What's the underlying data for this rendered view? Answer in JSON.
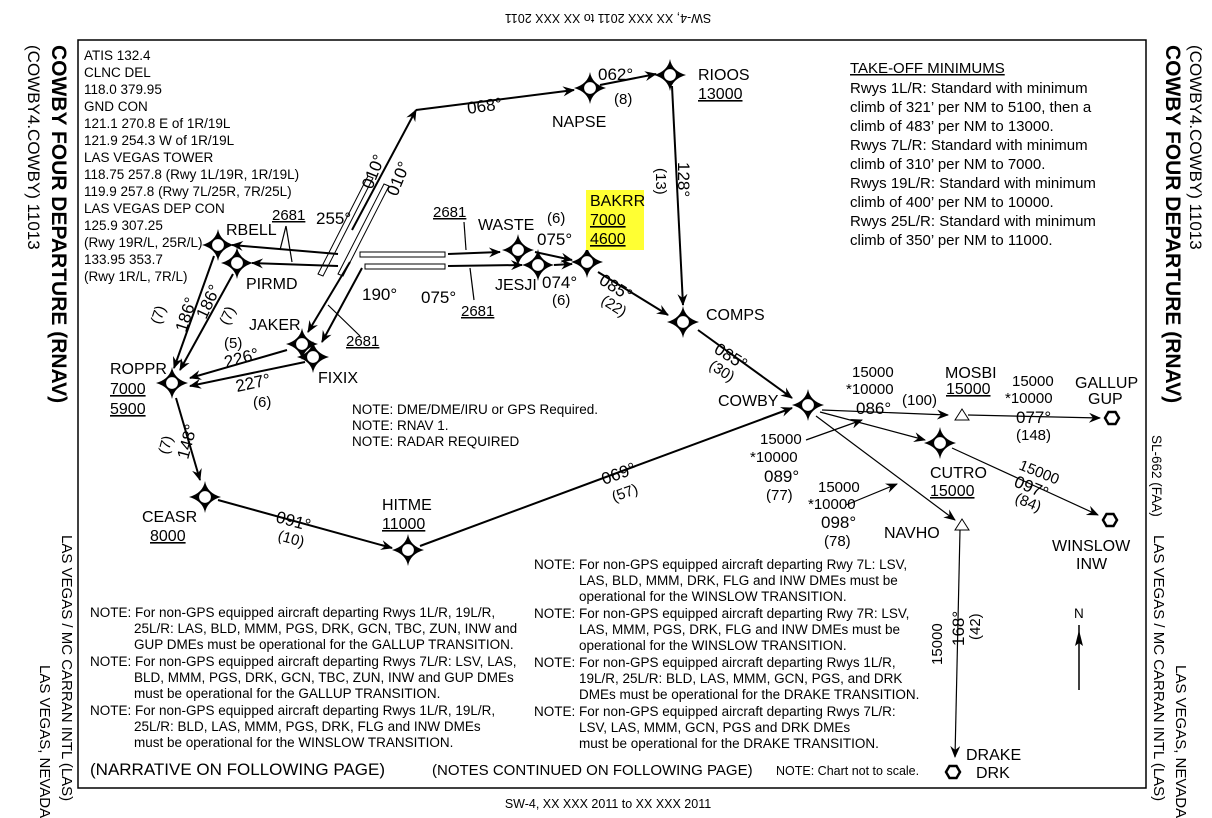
{
  "header": {
    "top_inverted": "SW-4, XX XXX 2011 to XX XXX 2011",
    "bottom": "SW-4, XX XXX 2011 to XX XXX 2011"
  },
  "left_margin": {
    "title": "COWBY FOUR DEPARTURE  (RNAV)",
    "code": "(COWBY4.COWBY)  11013",
    "city": "LAS VEGAS, NEVADA",
    "airport": "LAS VEGAS / MC CARRAN INTL (LAS)"
  },
  "right_margin": {
    "title": "COWBY FOUR DEPARTURE  (RNAV)",
    "code": "(COWBY4.COWBY)  11013",
    "sl": "SL-662 (FAA)",
    "city": "LAS VEGAS, NEVADA",
    "airport": "LAS VEGAS / MC CARRAN INTL (LAS)"
  },
  "frequencies": [
    "ATIS 132.4",
    "CLNC DEL",
    "118.0  379.95",
    "GND CON",
    "121.1  270.8 E of 1R/19L",
    "121.9  254.3 W of 1R/19L",
    "LAS VEGAS TOWER",
    "118.75  257.8 (Rwy 1L/19R, 1R/19L)",
    "119.9  257.8 (Rwy 7L/25R, 7R/25L)",
    "LAS VEGAS DEP CON",
    "125.9  307.25",
    "(Rwy 19R/L, 25R/L)",
    "133.95  353.7",
    "(Rwy 1R/L, 7R/L)"
  ],
  "takeoff_minimums": {
    "title": "TAKE-OFF MINIMUMS",
    "lines": [
      "Rwys 1L/R: Standard with minimum",
      "climb of 321’ per NM to 5100, then a",
      "climb of 483’ per NM to 13000.",
      "Rwys 7L/R: Standard with minimum",
      "climb of 310’ per NM to 7000.",
      "Rwys 19L/R: Standard with minimum",
      "climb of 400’ per NM to 10000.",
      "Rwys 25L/R: Standard with minimum",
      "climb of 350’ per NM to 11000."
    ]
  },
  "fixes": {
    "rbell": "RBELL",
    "pirmd": "PIRMD",
    "waste": "WASTE",
    "jesji": "JESJI",
    "bakrr": {
      "name": "BAKRR",
      "alt1": "7000",
      "alt2": "4600",
      "highlight": "#ffff33"
    },
    "napse": "NAPSE",
    "rioos": {
      "name": "RIOOS",
      "alt": "13000"
    },
    "comps": "COMPS",
    "cowby": "COWBY",
    "roppr": {
      "name": "ROPPR",
      "alt1": "7000",
      "alt2": "5900"
    },
    "jaker": "JAKER",
    "fixix": "FIXIX",
    "ceasr": {
      "name": "CEASR",
      "alt": "8000"
    },
    "hitme": {
      "name": "HITME",
      "alt": "11000"
    },
    "mosbi": {
      "name": "MOSBI",
      "alt": "15000"
    },
    "cutro": {
      "name": "CUTRO",
      "alt": "15000"
    },
    "navho": "NAVHO",
    "gallup": {
      "name": "GALLUP",
      "id": "GUP"
    },
    "winslow": {
      "name": "WINSLOW",
      "id": "INW"
    },
    "drake": {
      "name": "DRAKE",
      "id": "DRK"
    }
  },
  "legs": {
    "c068": "068°",
    "c062": "062°",
    "d8": "(8)",
    "c010a": "010°",
    "c010b": "010°",
    "c128": "128°",
    "d13": "(13)",
    "c255": "255°",
    "alt2681": "2681",
    "c190": "190°",
    "c075a": "075°",
    "c075b": "075°",
    "d6a": "(6)",
    "c074": "074°",
    "d6b": "(6)",
    "c085a": "085°",
    "d22": "(22)",
    "c085b": "085°",
    "d30": "(30)",
    "c186a": "186°",
    "d7a": "(7)",
    "c186b": "186°",
    "d7b": "(7)",
    "d5": "(5)",
    "c226": "226°",
    "c227": "227°",
    "d6c": "(6)",
    "c148": "148°",
    "d7c": "(7)",
    "c091": "091°",
    "d10": "(10)",
    "c069": "069°",
    "d57": "(57)",
    "alt15000": "15000",
    "alt10000": "*10000",
    "c086": "086°",
    "d100": "(100)",
    "c077": "077°",
    "d148": "(148)",
    "c089": "089°",
    "d77": "(77)",
    "c098": "098°",
    "d78": "(78)",
    "c097": "097°",
    "d84": "(84)",
    "c168": "168°",
    "d42": "(42)"
  },
  "center_notes": [
    "NOTE:  DME/DME/IRU or GPS Required.",
    "NOTE:  RNAV 1.",
    "NOTE:  RADAR REQUIRED"
  ],
  "notes_left": [
    "NOTE: For non-GPS equipped aircraft departing Rwys 1L/R, 19L/R,",
    "25L/R: LAS, BLD, MMM, PGS, DRK, GCN, TBC, ZUN, INW and",
    "GUP DMEs must be operational for the GALLUP TRANSITION.",
    "NOTE: For non-GPS equipped aircraft departing Rwys 7L/R: LSV, LAS,",
    "BLD, MMM, PGS, DRK, GCN, TBC, ZUN, INW and GUP DMEs",
    "must be operational for the GALLUP TRANSITION.",
    "NOTE: For non-GPS equipped aircraft departing Rwys 1L/R, 19L/R,",
    "25L/R: BLD, LAS, MMM, PGS, DRK, FLG and INW DMEs",
    "must be operational for the WINSLOW TRANSITION."
  ],
  "notes_right": [
    "NOTE: For non-GPS equipped aircraft departing Rwy 7L: LSV,",
    "LAS, BLD, MMM, DRK, FLG and INW DMEs must be",
    "operational for the WINSLOW TRANSITION.",
    "NOTE: For non-GPS equipped aircraft departing Rwy 7R: LSV,",
    "LAS, MMM, PGS, DRK, FLG and INW DMEs must be",
    "operational for the WINSLOW TRANSITION.",
    "NOTE: For non-GPS equipped aircraft departing Rwys 1L/R,",
    "19L/R, 25L/R: BLD, LAS, MMM, GCN, PGS, and DRK",
    "DMEs must be operational for the DRAKE TRANSITION.",
    "NOTE: For non-GPS equipped aircraft departing Rwys 7L/R:",
    "LSV, LAS, MMM, GCN, PGS and DRK DMEs",
    "must be operational for the DRAKE TRANSITION."
  ],
  "footer": {
    "narrative": "(NARRATIVE ON FOLLOWING PAGE)",
    "continued": "(NOTES CONTINUED ON FOLLOWING PAGE)",
    "scale": "NOTE:  Chart not to scale."
  },
  "north": "N"
}
